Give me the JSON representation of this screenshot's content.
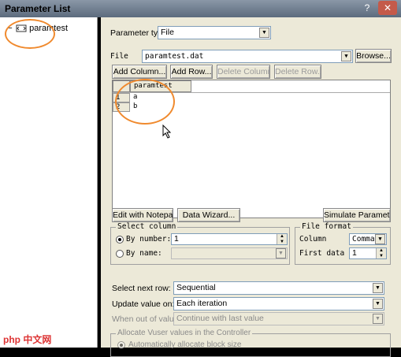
{
  "window": {
    "title": "Parameter List",
    "help_label": "?",
    "close_label": "✕"
  },
  "tree": {
    "items": [
      {
        "label": "paramtest",
        "icon": "parameter-icon"
      }
    ],
    "minus": "−"
  },
  "form": {
    "parameter_type_label": "Parameter type:",
    "parameter_type_value": "File",
    "file_label": "File",
    "file_value": "paramtest.dat",
    "browse_label": "Browse...",
    "add_column_label": "Add Column...",
    "add_row_label": "Add Row...",
    "delete_column_label": "Delete Column...",
    "delete_row_label": "Delete Row..."
  },
  "grid": {
    "column_header": "paramtest",
    "rows": [
      {
        "num": "1",
        "value": "a"
      },
      {
        "num": "2",
        "value": "b"
      }
    ]
  },
  "actions": {
    "edit_notepad_label": "Edit with Notepad...",
    "data_wizard_label": "Data Wizard...",
    "simulate_label": "Simulate Parameter..."
  },
  "select_column": {
    "title": "Select column",
    "by_number_label": "By number:",
    "by_number_value": "1",
    "by_name_label": "By name:",
    "by_name_value": ""
  },
  "file_format": {
    "title": "File format",
    "column_label": "Column",
    "column_value": "Comma",
    "first_data_label": "First data",
    "first_data_value": "1"
  },
  "options": {
    "select_next_row_label": "Select next row:",
    "select_next_row_value": "Sequential",
    "update_value_label": "Update value on:",
    "update_value_value": "Each iteration",
    "when_out_label": "When out of values:",
    "when_out_value": "Continue with last value"
  },
  "allocate": {
    "title": "Allocate Vuser values in the Controller",
    "auto_label": "Automatically allocate block size"
  },
  "watermark": "php 中文网",
  "colors": {
    "highlight": "#f08a2e",
    "panel": "#ece9d8"
  }
}
